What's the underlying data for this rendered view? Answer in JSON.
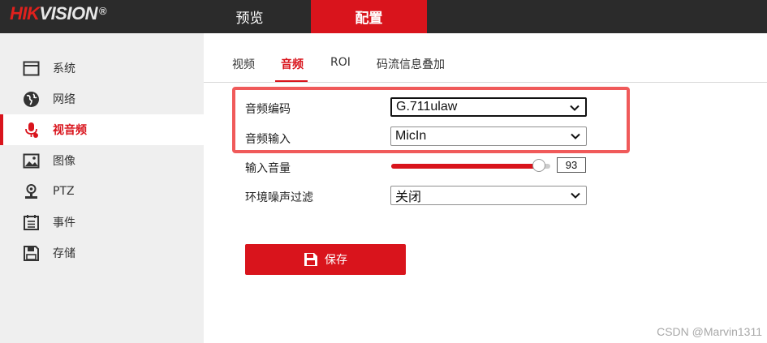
{
  "brand": {
    "logo_hik": "HIK",
    "logo_vision": "VISION",
    "logo_reg": "®"
  },
  "topnav": {
    "preview": "预览",
    "config": "配置"
  },
  "sidebar": {
    "items": [
      {
        "label": "系统",
        "icon": "system-window-icon"
      },
      {
        "label": "网络",
        "icon": "globe-icon"
      },
      {
        "label": "视音频",
        "icon": "microphone-icon",
        "active": true
      },
      {
        "label": "图像",
        "icon": "image-icon"
      },
      {
        "label": "PTZ",
        "icon": "ptz-icon"
      },
      {
        "label": "事件",
        "icon": "event-list-icon"
      },
      {
        "label": "存储",
        "icon": "storage-save-icon"
      }
    ]
  },
  "tabs": {
    "items": [
      {
        "label": "视频"
      },
      {
        "label": "音频",
        "active": true
      },
      {
        "label": "ROI"
      },
      {
        "label": "码流信息叠加"
      }
    ]
  },
  "form": {
    "audio_encoding": {
      "label": "音频编码",
      "value": "G.711ulaw"
    },
    "audio_input": {
      "label": "音频输入",
      "value": "MicIn"
    },
    "input_volume": {
      "label": "输入音量",
      "value": "93"
    },
    "noise_filter": {
      "label": "环境噪声过滤",
      "value": "关闭"
    }
  },
  "save_label": "保存",
  "watermark": "CSDN @Marvin1311",
  "colors": {
    "accent": "#d9141c",
    "highlight": "#f05a5a",
    "topbar": "#2b2b2b",
    "sidebar": "#efefef"
  }
}
